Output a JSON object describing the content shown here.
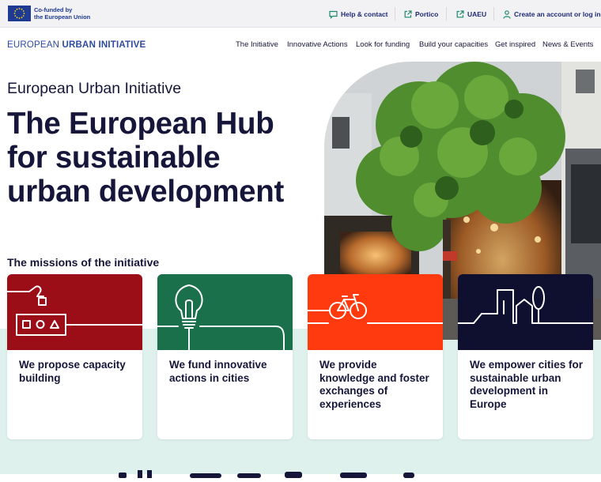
{
  "topbar": {
    "eu_label_line1": "Co-funded by",
    "eu_label_line2": "the European Union",
    "links": [
      {
        "label": "Help & contact",
        "icon": "chat-icon"
      },
      {
        "label": "Portico",
        "icon": "external-link-icon"
      },
      {
        "label": "UAEU",
        "icon": "external-link-icon"
      },
      {
        "label": "Create an account or log in",
        "icon": "user-icon"
      }
    ]
  },
  "header": {
    "logo_part1": "EUROPEAN ",
    "logo_part2": "URBAN INITIATIVE",
    "nav": [
      "The Initiative",
      "Innovative Actions",
      "Look for funding",
      "Build your capacities",
      "Get inspired",
      "News & Events"
    ]
  },
  "hero": {
    "subtitle": "European Urban Initiative",
    "title_lines": [
      "The European Hub",
      "for sustainable",
      "urban development"
    ]
  },
  "missions": {
    "title": "The missions of the initiative",
    "cards": [
      {
        "text": "We propose capacity building",
        "color": "#9b0e17",
        "icon": "capacity-building-icon"
      },
      {
        "text": "We fund innovative actions in cities",
        "color": "#19704b",
        "icon": "lightbulb-icon"
      },
      {
        "text": "We provide knowledge and foster exchanges of experiences",
        "color": "#ff3a0f",
        "icon": "bicycle-icon"
      },
      {
        "text": "We empower cities for sustainable urban development in Europe",
        "color": "#0f1030",
        "icon": "city-skyline-icon"
      }
    ]
  },
  "colors": {
    "navy": "#16163a",
    "brand_blue": "#2d4ba0",
    "mint": "#dff1ed"
  }
}
